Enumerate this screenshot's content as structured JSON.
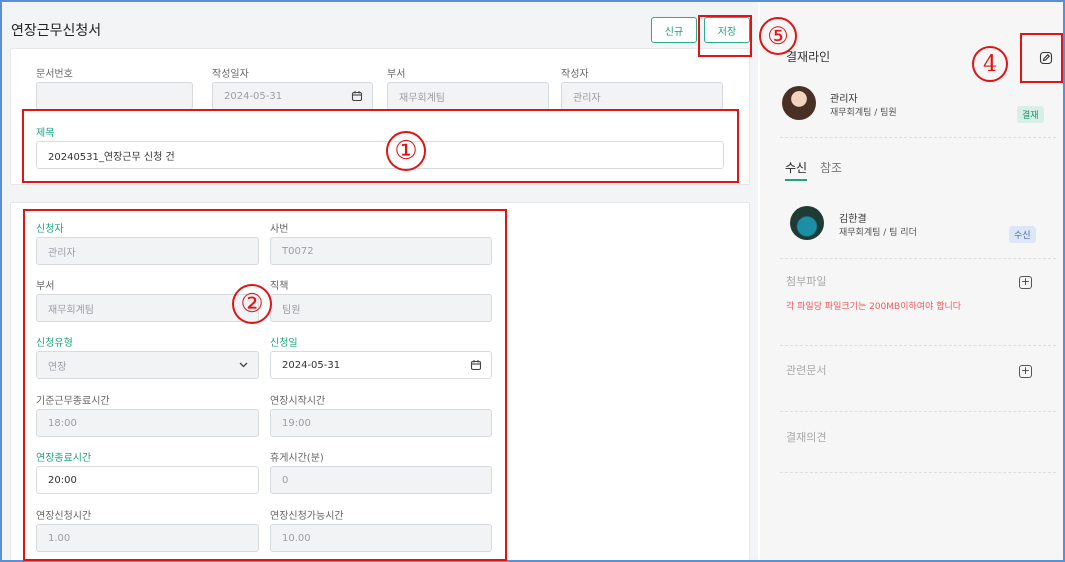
{
  "header": {
    "title": "연장근무신청서",
    "new_label": "신규",
    "save_label": "저장"
  },
  "doc": {
    "doc_no_label": "문서번호",
    "doc_no_value": "",
    "date_label": "작성일자",
    "date_value": "2024-05-31",
    "dept_label": "부서",
    "dept_value": "재무회계팀",
    "author_label": "작성자",
    "author_value": "관리자",
    "subject_label": "제목",
    "subject_value": "20240531_연장근무 신청 건"
  },
  "form": {
    "applicant_label": "신청자",
    "applicant_value": "관리자",
    "emp_no_label": "사번",
    "emp_no_value": "T0072",
    "dept_label": "부서",
    "dept_value": "재무회계팀",
    "position_label": "직책",
    "position_value": "팀원",
    "type_label": "신청유형",
    "type_value": "연장",
    "apply_date_label": "신청일",
    "apply_date_value": "2024-05-31",
    "std_end_label": "기준근무종료시간",
    "std_end_value": "18:00",
    "ext_start_label": "연장시작시간",
    "ext_start_value": "19:00",
    "ext_end_label": "연장종료시간",
    "ext_end_value": "20:00",
    "break_label": "휴게시간(분)",
    "break_value": "0",
    "ext_hours_label": "연장신청시간",
    "ext_hours_value": "1.00",
    "ext_avail_label": "연장신청가능시간",
    "ext_avail_value": "10.00"
  },
  "sidebar": {
    "approval_title": "결재라인",
    "approver_name": "관리자",
    "approver_dept": "재무회계팀 / 팀원",
    "approver_badge": "결재",
    "tab_receive": "수신",
    "tab_reference": "참조",
    "receiver_name": "김한결",
    "receiver_dept": "재무회계팀 / 팀 리더",
    "receiver_badge": "수신",
    "attach_title": "첨부파일",
    "attach_note": "각 파일당 파일크기는 200MB이하여야 합니다",
    "related_title": "관련문서",
    "opinion_title": "결재의견"
  },
  "annotations": {
    "n1": "①",
    "n2": "②",
    "n4": "4",
    "n5": "⑤"
  },
  "colors": {
    "accent": "#1fa37f",
    "annotation": "#e01414",
    "frame": "#5b8fd6",
    "warning": "#f05a5a"
  }
}
